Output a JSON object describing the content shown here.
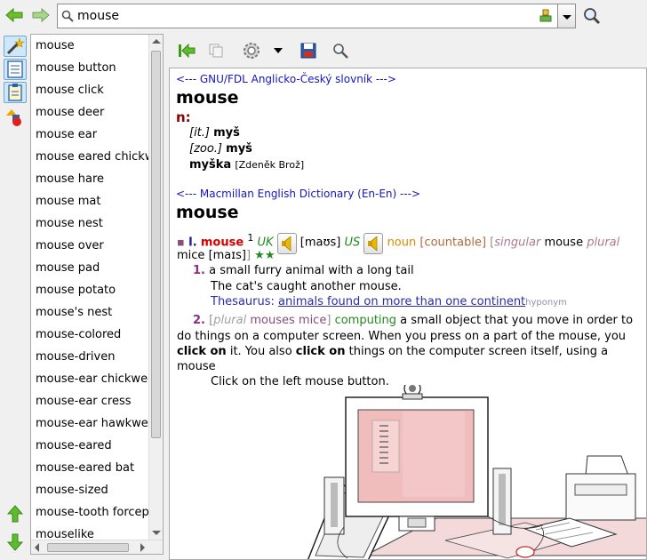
{
  "search": {
    "value": "mouse"
  },
  "word_list": [
    "mouse",
    "mouse button",
    "mouse click",
    "mouse deer",
    "mouse ear",
    "mouse eared chickweed",
    "mouse hare",
    "mouse mat",
    "mouse nest",
    "mouse over",
    "mouse pad",
    "mouse potato",
    "mouse's nest",
    "mouse-colored",
    "mouse-driven",
    "mouse-ear chickweed",
    "mouse-ear cress",
    "mouse-ear hawkweed",
    "mouse-eared",
    "mouse-eared bat",
    "mouse-sized",
    "mouse-tooth forceps",
    "mouselike"
  ],
  "article": {
    "gnu": {
      "header": "<--- GNU/FDL Anglicko-Český slovník --->",
      "headword": "mouse",
      "pos": "n:",
      "s1_tag": "[it.]",
      "s1_word": "myš",
      "s2_tag": "[zoo.]",
      "s2_word": "myš",
      "s3_word": "myška",
      "s3_author": "[Zdeněk Brož]"
    },
    "mac": {
      "header": "<--- Macmillan English Dictionary (En-En) --->",
      "headword": "mouse",
      "bullet": "▪",
      "roman": "I.",
      "word": "mouse",
      "sup": "1",
      "uk": "UK",
      "ipa_uk": "[maʊs]",
      "us": "US",
      "pos": "noun",
      "countable": "[countable]",
      "bracket_open": "[",
      "singular": "singular",
      "mouse2": "mouse",
      "plural": "plural",
      "mice": "mice",
      "ipa_mice": "[maɪs]",
      "bracket_close": "]",
      "stars": "★★",
      "s1_num": "1.",
      "s1_def": "a small furry animal with a long tail",
      "s1_ex": "The cat's caught another mouse.",
      "thes_label": "Thesaurus:",
      "thes_link": "animals found on more than one continent",
      "hyponym": "hyponym",
      "s2_num": "2.",
      "s2_bracket_open": "[",
      "s2_plural": "plural",
      "s2_forms": "mouses mice",
      "s2_bracket_close": "]",
      "s2_domain": "computing",
      "s2_def_a": "a small object that you move in order to",
      "s2_def_b": "do things on a computer screen. When you press on a part of the mouse, you",
      "s2_click1": "click on",
      "s2_def_c": "it. You also",
      "s2_click2": "click on",
      "s2_def_d": "things on the computer screen itself, using a",
      "s2_def_e": "mouse",
      "s2_ex": "Click on the left mouse button."
    }
  }
}
